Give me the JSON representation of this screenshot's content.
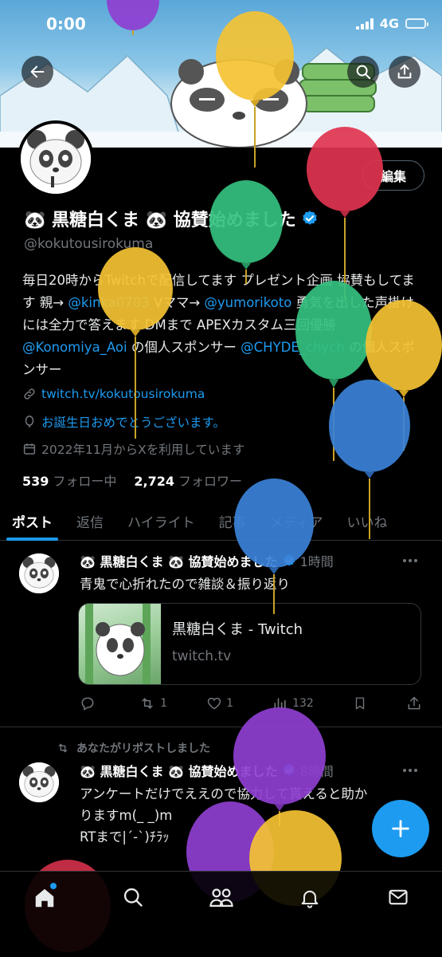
{
  "status_bar": {
    "time": "0:00",
    "network": "4G"
  },
  "profile": {
    "edit_label": "編集",
    "display_name": "🐼 黒糖白くま 🐼 協賛始めました",
    "handle": "@kokutousirokuma",
    "bio": {
      "part1": "毎日20時からTwitchで配信してます プレゼント企画 協賛もしてます 親→ ",
      "mention1": "@kinka0703",
      "part2": " Vママ→ ",
      "mention2": "@yumorikoto",
      "part3": " 勇気を出した声掛けには全力で答えます DMまで APEXカスタム三回優勝 ",
      "mention3": "@Konomiya_Aoi",
      "part4": " の個人スポンサー ",
      "mention4": "@CHYDE_chych",
      "part5": " の個人スポンサー"
    },
    "link": "twitch.tv/kokutousirokuma",
    "birthday": "お誕生日おめでとうございます。",
    "joined": "2022年11月からXを利用しています",
    "following_count": "539",
    "following_label": "フォロー中",
    "followers_count": "2,724",
    "followers_label": "フォロワー"
  },
  "tabs": [
    {
      "label": "ポスト"
    },
    {
      "label": "返信"
    },
    {
      "label": "ハイライト"
    },
    {
      "label": "記事"
    },
    {
      "label": "メディア"
    },
    {
      "label": "いいね"
    }
  ],
  "posts": [
    {
      "name": "🐼 黒糖白くま 🐼 協賛始めました",
      "time": "1時間",
      "text": "青鬼で心折れたので雑談＆振り返り",
      "card": {
        "title": "黒糖白くま - Twitch",
        "domain": "twitch.tv"
      },
      "actions": {
        "replies": "",
        "reposts": "1",
        "likes": "1",
        "views": "132"
      }
    },
    {
      "repost_note": "あなたがリポストしました",
      "name": "🐼 黒糖白くま 🐼 協賛始めました",
      "time": "8時間",
      "text_line1": "アンケートだけでええので協力して貰えると助か",
      "text_line2": "りますm(_ _)m",
      "text_line3": "RTまで|´-`)ﾁﾗｯ"
    }
  ],
  "colors": {
    "accent": "#1d9bf0",
    "background": "#000000",
    "secondary_text": "#71767b",
    "border": "#2f3336"
  },
  "icons": {
    "back": "arrow-left-icon",
    "search": "search-icon",
    "share": "share-icon",
    "verified": "verified-badge-icon",
    "link": "link-icon",
    "balloon": "balloon-icon",
    "calendar": "calendar-icon",
    "reply": "reply-icon",
    "repost": "repost-icon",
    "like": "heart-icon",
    "views": "views-icon",
    "bookmark": "bookmark-icon",
    "compose": "plus-icon",
    "home": "home-icon",
    "communities": "communities-icon",
    "notifications": "bell-icon",
    "messages": "mail-icon"
  }
}
